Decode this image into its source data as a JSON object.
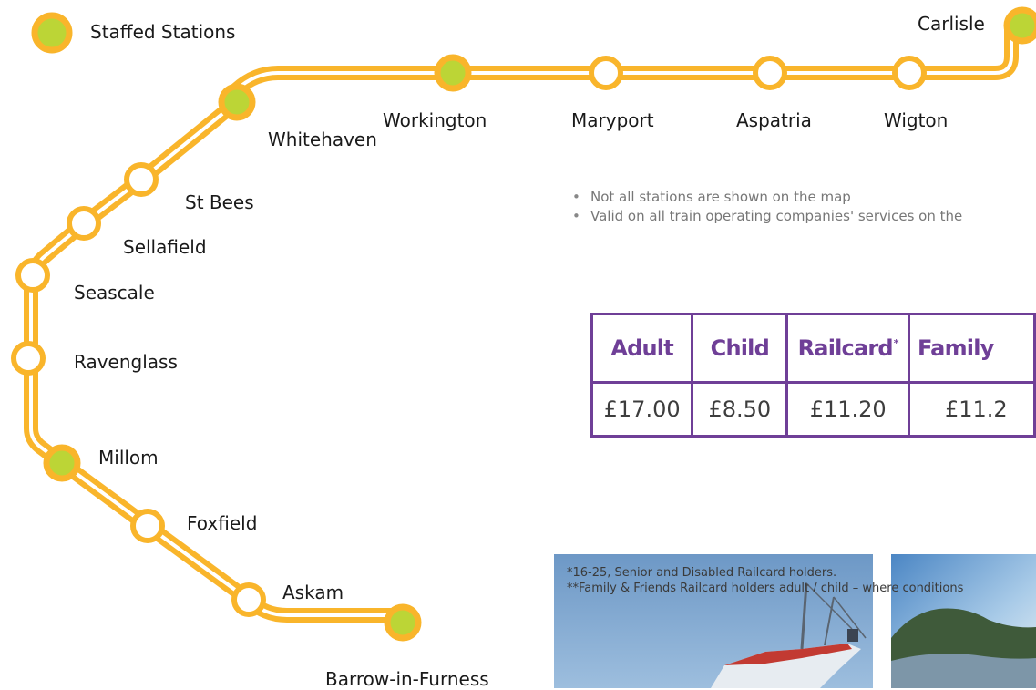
{
  "legend": {
    "label": "Staffed Stations"
  },
  "stations": [
    {
      "id": "carlisle",
      "name": "Carlisle",
      "staffed": true
    },
    {
      "id": "wigton",
      "name": "Wigton",
      "staffed": false
    },
    {
      "id": "aspatria",
      "name": "Aspatria",
      "staffed": false
    },
    {
      "id": "maryport",
      "name": "Maryport",
      "staffed": false
    },
    {
      "id": "workington",
      "name": "Workington",
      "staffed": true
    },
    {
      "id": "whitehaven",
      "name": "Whitehaven",
      "staffed": true
    },
    {
      "id": "st-bees",
      "name": "St Bees",
      "staffed": false
    },
    {
      "id": "sellafield",
      "name": "Sellafield",
      "staffed": false
    },
    {
      "id": "seascale",
      "name": "Seascale",
      "staffed": false
    },
    {
      "id": "ravenglass",
      "name": "Ravenglass",
      "staffed": false
    },
    {
      "id": "millom",
      "name": "Millom",
      "staffed": true
    },
    {
      "id": "foxfield",
      "name": "Foxfield",
      "staffed": false
    },
    {
      "id": "askam",
      "name": "Askam",
      "staffed": false
    },
    {
      "id": "barrow",
      "name": "Barrow-in-Furness",
      "staffed": true
    }
  ],
  "notes": [
    "Not all stations are shown on the map",
    "Valid on all train operating companies' services on the"
  ],
  "fares": {
    "headers": [
      "Adult",
      "Child",
      "Railcard",
      "Family"
    ],
    "header_sup": "*",
    "values": [
      "£17.00",
      "£8.50",
      "£11.20",
      "£11.2"
    ]
  },
  "footnotes": [
    "*16-25, Senior and Disabled Railcard holders.",
    "**Family & Friends Railcard holders adult / child – where conditions"
  ],
  "colors": {
    "line": "#f9b52b",
    "staffed_fill": "#bcd536",
    "table_border": "#6f3f97",
    "table_header_text": "#6f3f97"
  },
  "photos": [
    "harbour-boat-photo",
    "coastal-headland-photo"
  ]
}
